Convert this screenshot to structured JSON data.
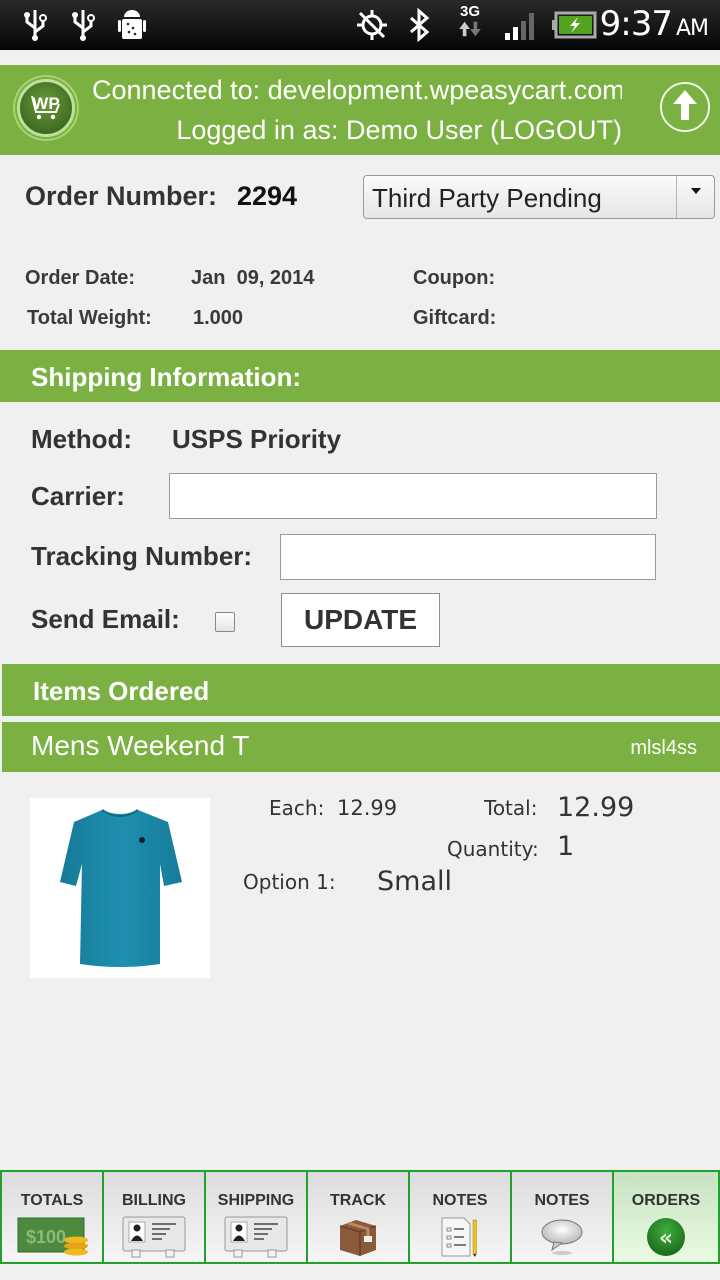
{
  "status_bar": {
    "time": "9:37",
    "ampm": "AM",
    "network": "3G",
    "icons": [
      "usb-icon",
      "usb-icon",
      "android-debug-icon",
      "gps-off-icon",
      "bluetooth-icon",
      "network-3g-icon",
      "signal-icon",
      "battery-charging-icon"
    ]
  },
  "header": {
    "connected_line": "Connected to: development.wpeasycart.com",
    "logged_in_line": "Logged in as: Demo User   (LOGOUT)",
    "logo_text": "WP",
    "upload_icon": "arrow-up-circle-icon"
  },
  "order": {
    "number_label": "Order Number:",
    "number": "2294",
    "status_selected": "Third Party Pending",
    "order_date_label": "Order Date:",
    "order_date": "Jan  09, 2014",
    "total_weight_label": "Total Weight:",
    "total_weight": "1.000",
    "coupon_label": "Coupon:",
    "coupon": "",
    "giftcard_label": "Giftcard:",
    "giftcard": ""
  },
  "shipping": {
    "title": "Shipping Information:",
    "method_label": "Method:",
    "method": "USPS Priority",
    "carrier_label": "Carrier:",
    "carrier_value": "",
    "tracking_label": "Tracking Number:",
    "tracking_value": "",
    "send_email_label": "Send Email:",
    "send_email_checked": false,
    "update_label": "UPDATE"
  },
  "items": {
    "title": "Items Ordered",
    "list": [
      {
        "name": "Mens Weekend T",
        "sku": "mlsl4ss",
        "each_label": "Each:",
        "each": "12.99",
        "total_label": "Total:",
        "total": "12.99",
        "quantity_label": "Quantity:",
        "quantity": "1",
        "option_label": "Option 1:",
        "option_value": "Small",
        "image_color": "#1e8aa8"
      }
    ]
  },
  "tabs": [
    {
      "label": "TOTALS",
      "icon": "money-icon"
    },
    {
      "label": "BILLING",
      "icon": "contact-card-icon"
    },
    {
      "label": "SHIPPING",
      "icon": "contact-card-icon"
    },
    {
      "label": "TRACK",
      "icon": "package-icon"
    },
    {
      "label": "NOTES",
      "icon": "document-pencil-icon"
    },
    {
      "label": "NOTES",
      "icon": "speech-bubble-icon"
    },
    {
      "label": "ORDERS",
      "icon": "back-double-chevron-icon",
      "active": true
    }
  ],
  "colors": {
    "brand_green": "#7bb042",
    "tab_border": "#22a22c",
    "background": "#f0f0f0"
  }
}
